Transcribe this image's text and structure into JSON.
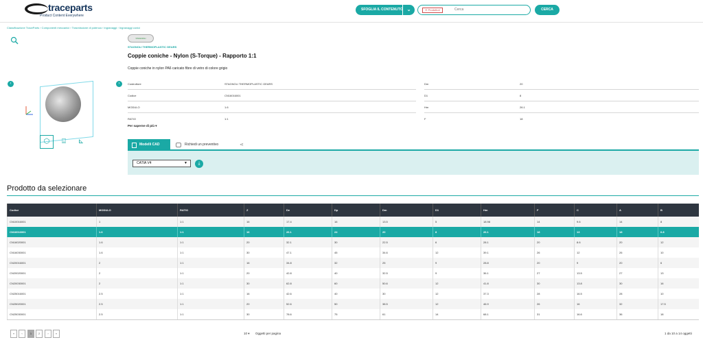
{
  "header": {
    "logo_text": "traceparts",
    "logo_tagline": "Product Content Everywhere",
    "browse_label": "SFOGLIA IL CONTENUTO",
    "search_chip": "Produttori",
    "search_placeholder": "Cerca",
    "search_button": "CERCA"
  },
  "breadcrumb": "Classificazione TraceParts › Componenti meccanici › Trasmissione di potenza › Ingranaggi › Ingranaggi conici",
  "product": {
    "brand_logo_text": "STAGNOLI",
    "brand_name": "STAGNOLI THERMOPLASTIC GEARS",
    "title": "Coppie coniche - Nylon (S-Torque) - Rapporto 1:1",
    "description": "Coppie coniche in nylon PA6 caricato fibre di vetro di colore grigio",
    "more_info": "Per saperne di più",
    "properties_left": [
      {
        "label": "Costruttore",
        "value": "STAGNOLI THERMOPLASTIC GEARS"
      },
      {
        "label": "Codice",
        "value": "CN16016001"
      },
      {
        "label": "MODULO",
        "value": "1.6"
      },
      {
        "label": "RATIO",
        "value": "1:1"
      }
    ],
    "properties_right": [
      {
        "label": "Dm",
        "value": "20"
      },
      {
        "label": "D1",
        "value": "8"
      },
      {
        "label": "Hm",
        "value": "26.1"
      },
      {
        "label": "F",
        "value": "18"
      }
    ]
  },
  "cad": {
    "tab_models": "Modelli CAD",
    "tab_quote": "Richiedi un preventivo",
    "format_selected": "CATIA V4"
  },
  "grid": {
    "section_title": "Prodotto da selezionare",
    "columns": [
      "Codice",
      "MODULO",
      "RATIO",
      "Z",
      "De",
      "Dp",
      "Dm",
      "D1",
      "Hm",
      "F",
      "C",
      "A",
      "B"
    ],
    "rows": [
      [
        "CN10016001",
        "1",
        "1:1",
        "16",
        "17.4",
        "16",
        "13.5",
        "5",
        "18.98",
        "14",
        "9.6",
        "14",
        "8"
      ],
      [
        "CN16016001",
        "1.6",
        "1:1",
        "16",
        "26.1",
        "24",
        "20",
        "8",
        "26.1",
        "18",
        "13",
        "18",
        "6.8"
      ],
      [
        "CN16020001",
        "1.6",
        "1:1",
        "20",
        "32.1",
        "30",
        "22.5",
        "6",
        "28.1",
        "20",
        "8.6",
        "20",
        "12"
      ],
      [
        "CN16030001",
        "1.6",
        "1:1",
        "30",
        "47.1",
        "45",
        "34.6",
        "12",
        "39.1",
        "26",
        "12",
        "26",
        "10"
      ],
      [
        "CN20016001",
        "2",
        "1:1",
        "16",
        "34.8",
        "32",
        "25",
        "9",
        "28.8",
        "20",
        "9",
        "20",
        "6"
      ],
      [
        "CN20020001",
        "2",
        "1:1",
        "20",
        "42.8",
        "40",
        "32.5",
        "9",
        "36.1",
        "27",
        "13.5",
        "27",
        "13"
      ],
      [
        "CN20030001",
        "2",
        "1:1",
        "30",
        "62.8",
        "60",
        "50.6",
        "12",
        "41.8",
        "30",
        "13.8",
        "30",
        "16"
      ],
      [
        "CN25016001",
        "2.5",
        "1:1",
        "16",
        "42.6",
        "40",
        "30",
        "12",
        "37.3",
        "28",
        "16.5",
        "28",
        "10"
      ],
      [
        "CN25020001",
        "2.5",
        "1:1",
        "20",
        "52.6",
        "50",
        "38.5",
        "12",
        "46.9",
        "26",
        "16",
        "32",
        "17.5"
      ],
      [
        "CN25030001",
        "2.5",
        "1:1",
        "30",
        "78.6",
        "75",
        "61",
        "14",
        "68.1",
        "31",
        "16.6",
        "36",
        "18"
      ]
    ],
    "selected_index": 1
  },
  "pager": {
    "first": "«",
    "prev": "‹",
    "page1": "1",
    "page2": "2",
    "next": "›",
    "last": "»",
    "per_page": "10",
    "per_page_label": "Oggetti per pagina",
    "range": "1 da 10 a 14 oggetti"
  },
  "colors": {
    "accent": "#1aa9a5",
    "header_dark": "#2e3640",
    "cad_panel": "#daf0f0"
  },
  "icons": {
    "zoom": "magnifier-icon",
    "prev": "chevron-left-icon",
    "next": "chevron-right-icon",
    "view_3d": "cube-icon",
    "view_photo": "camera-icon",
    "view_dims": "dimensions-icon",
    "download": "download-icon",
    "share": "share-icon"
  }
}
